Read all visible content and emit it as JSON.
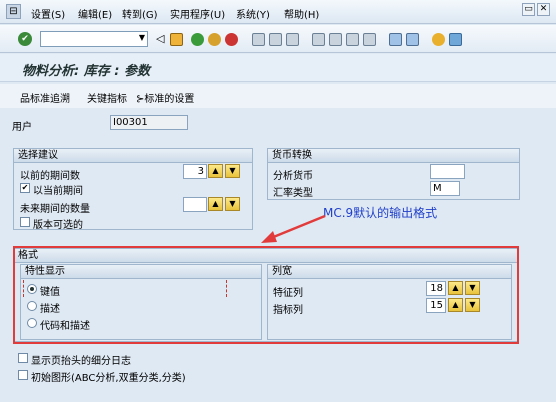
{
  "menu": [
    "设置(S)",
    "编辑(E)",
    "转到(G)",
    "实用程序(U)",
    "系统(Y)",
    "帮助(H)"
  ],
  "window_controls": [
    "▭",
    "✕"
  ],
  "toolbar": {
    "command_value": "",
    "icons": [
      "enter-icon",
      "back-icon",
      "save-icon",
      "exit-icon",
      "cancel-icon",
      "stop-icon",
      "print-icon",
      "find-icon",
      "find-next-icon",
      "first-page-icon",
      "prev-page-icon",
      "next-page-icon",
      "last-page-icon",
      "new-session-icon",
      "shortcut-icon",
      "help-icon",
      "customize-icon"
    ]
  },
  "page": {
    "title": "物料分析: 库存 : 参数"
  },
  "app_toolbar": {
    "standard_drilldown": "标准追溯",
    "key_figures": "关键指标",
    "standard_settings": "标准的设置"
  },
  "user": {
    "label": "用户",
    "value": "I00301"
  },
  "selection": {
    "title": "选择建议",
    "prev_periods_label": "以前的期间数",
    "prev_periods_value": "3",
    "current_period_label": "以当前期间",
    "current_period_checked": true,
    "future_periods_label": "未来期间的数量",
    "future_periods_value": "",
    "version_label": "版本可选的",
    "version_checked": false
  },
  "currency": {
    "title": "货币转换",
    "analysis_currency_label": "分析货币",
    "analysis_currency_value": "",
    "rate_type_label": "汇率类型",
    "rate_type_value": "M"
  },
  "annotation": "MC.9默认的输出格式",
  "format": {
    "title": "格式",
    "char_display": {
      "title": "特性显示",
      "options": [
        "键值",
        "描述",
        "代码和描述"
      ],
      "selected": 0
    },
    "col_width": {
      "title": "列宽",
      "char_col_label": "特征列",
      "char_col_value": "18",
      "kf_col_label": "指标列",
      "kf_col_value": "15"
    }
  },
  "bottom": {
    "log_label": "显示页抬头的细分日志",
    "graphics_label": "初始图形(ABC分析,双重分类,分类)"
  },
  "colors": {
    "accent_red": "#e23b3b",
    "annotation_blue": "#2140c9"
  }
}
